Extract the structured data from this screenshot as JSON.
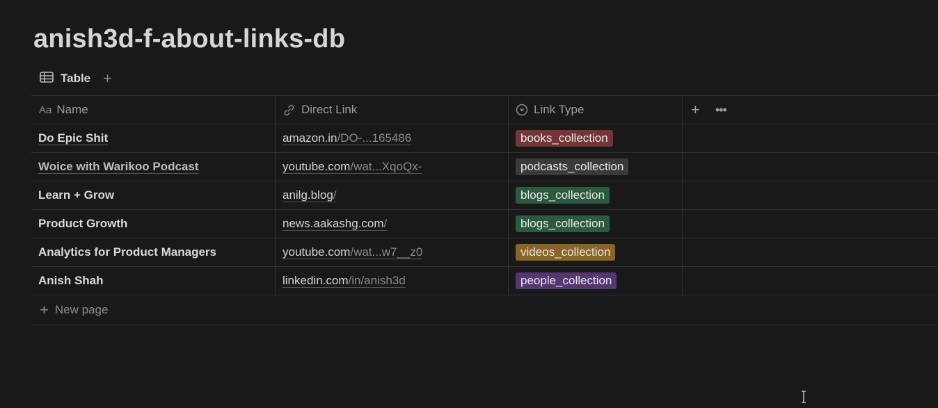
{
  "page": {
    "title": "anish3d-f-about-links-db"
  },
  "views": {
    "active_label": "Table"
  },
  "columns": {
    "name": "Name",
    "link": "Direct Link",
    "type": "Link Type"
  },
  "column_icons": {
    "name": "Aa",
    "link": "link-icon",
    "type": "select-icon"
  },
  "rows": [
    {
      "name": "Do Epic Shit",
      "link_host": "amazon.in",
      "link_rest": "/DO-...165486",
      "type": "books_collection",
      "type_color": "#733535"
    },
    {
      "name": "Woice with Warikoo Podcast",
      "link_host": "youtube.com",
      "link_rest": "/wat...XqoQx-",
      "type": "podcasts_collection",
      "type_color": "#3a3a3a"
    },
    {
      "name": "Learn + Grow",
      "link_host": "anilg.blog",
      "link_rest": "/",
      "type": "blogs_collection",
      "type_color": "#2b5a3f"
    },
    {
      "name": "Product Growth",
      "link_host": "news.aakashg.com",
      "link_rest": "/",
      "type": "blogs_collection",
      "type_color": "#2b5a3f"
    },
    {
      "name": "Analytics for Product Managers",
      "link_host": "youtube.com",
      "link_rest": "/wat...w7__z0",
      "type": "videos_collection",
      "type_color": "#8a6424"
    },
    {
      "name": "Anish Shah",
      "link_host": "linkedin.com",
      "link_rest": "/in/anish3d",
      "type": "people_collection",
      "type_color": "#553673"
    }
  ],
  "footer": {
    "new_page_label": "New page"
  }
}
